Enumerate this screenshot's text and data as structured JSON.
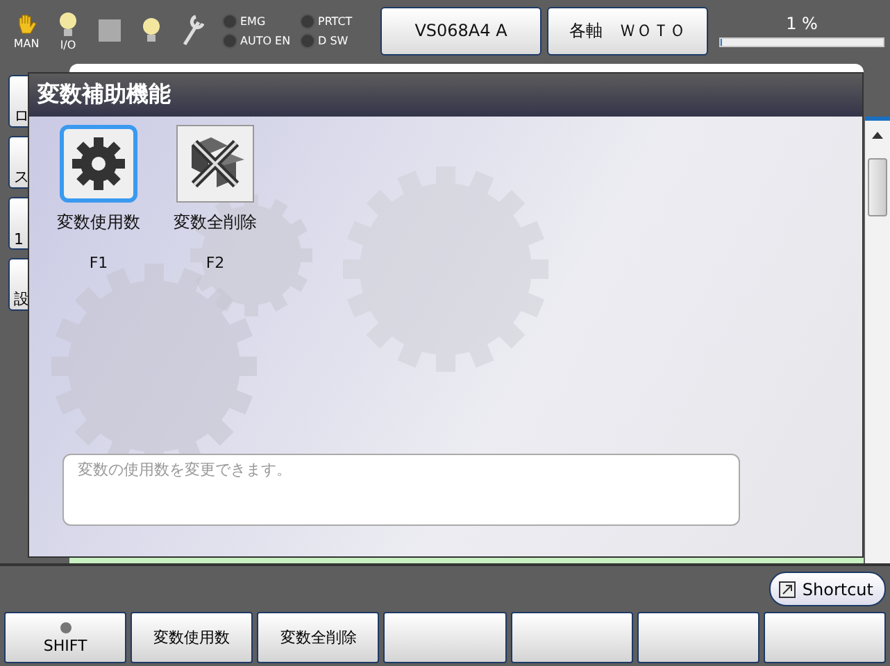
{
  "status_bar": {
    "icons": [
      {
        "kind": "hand",
        "label": "MAN"
      },
      {
        "kind": "bulb",
        "label": "I/O"
      },
      {
        "kind": "square"
      },
      {
        "kind": "bulb"
      },
      {
        "kind": "wrench"
      }
    ],
    "indicators": [
      {
        "label": "EMG",
        "on": false
      },
      {
        "label": "PRTCT",
        "on": false
      },
      {
        "label": "AUTO EN",
        "on": false
      },
      {
        "label": "D SW",
        "on": false
      }
    ],
    "buttons": [
      "VS068A4 A",
      "各軸　ＷＯＴＯ"
    ],
    "speed": {
      "reading": "1 %",
      "level": 0.01
    }
  },
  "background": {
    "side_buttons": [
      "ロ",
      "ス",
      "1",
      "設"
    ]
  },
  "dialog": {
    "title": "変数補助機能",
    "functions": [
      {
        "kind": "gear",
        "label": "変数使用数",
        "key": "F1",
        "selected": true
      },
      {
        "kind": "dice",
        "label": "変数全削除",
        "key": "F2",
        "selected": false
      }
    ],
    "description": "変数の使用数を変更できます。"
  },
  "shortcut": "Shortcut",
  "function_keys": [
    {
      "kind": "shift",
      "label": "SHIFT"
    },
    {
      "kind": "text",
      "label": "変数使用数"
    },
    {
      "kind": "text",
      "label": "変数全削除"
    },
    {
      "kind": "blank"
    },
    {
      "kind": "blank"
    },
    {
      "kind": "blank"
    },
    {
      "kind": "blank"
    }
  ]
}
